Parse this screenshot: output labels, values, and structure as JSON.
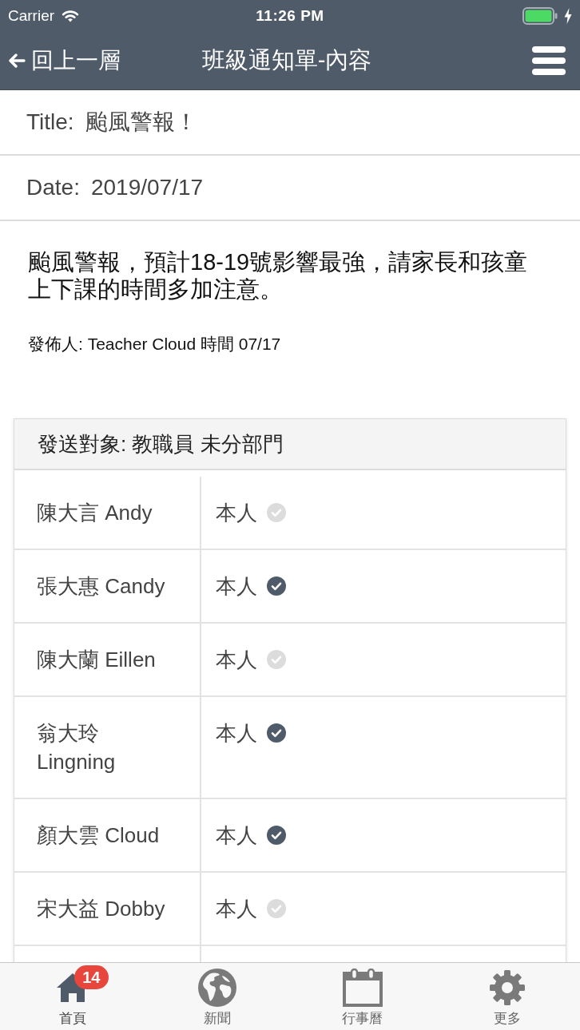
{
  "status_bar": {
    "carrier": "Carrier",
    "time": "11:26 PM"
  },
  "nav_bar": {
    "back_label": "回上一層",
    "title": "班級通知單-內容"
  },
  "fields": [
    {
      "label": "Title:",
      "value": "颱風警報！"
    },
    {
      "label": "Date:",
      "value": "2019/07/17"
    }
  ],
  "message": {
    "body": "颱風警報，預計18-19號影響最強，請家長和孩童上下課的時間多加注意。",
    "byline": "發佈人: Teacher Cloud 時間 07/17"
  },
  "recipients": {
    "heading": "發送對象: 教職員 未分部門",
    "rows": [
      {
        "name": "陳大言 Andy",
        "status": "本人",
        "read": false
      },
      {
        "name": "張大惠 Candy",
        "status": "本人",
        "read": true
      },
      {
        "name": "陳大蘭 Eillen",
        "status": "本人",
        "read": false
      },
      {
        "name": "翁大玲 Lingning",
        "status": "本人",
        "read": true
      },
      {
        "name": "顏大雲 Cloud",
        "status": "本人",
        "read": true
      },
      {
        "name": "宋大益 Dobby",
        "status": "本人",
        "read": false
      }
    ]
  },
  "tab_bar": [
    {
      "label": "首頁",
      "selected": true,
      "badge": "14"
    },
    {
      "label": "新聞",
      "selected": false
    },
    {
      "label": "行事曆",
      "selected": false
    },
    {
      "label": "更多",
      "selected": false
    }
  ]
}
